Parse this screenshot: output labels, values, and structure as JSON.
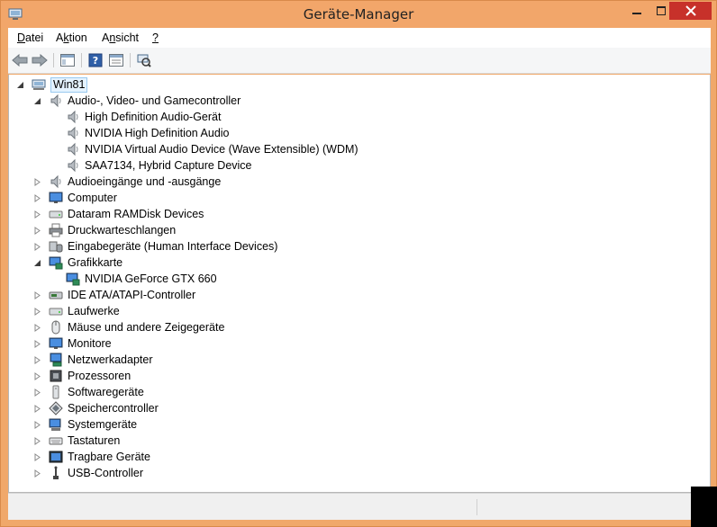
{
  "window": {
    "title": "Geräte-Manager",
    "accent": "#f2a66a",
    "close_color": "#c7312a"
  },
  "menu": {
    "items": [
      {
        "label": "Datei",
        "underline": "D",
        "rest": "atei"
      },
      {
        "label": "Aktion",
        "underline": "k",
        "pre": "A",
        "rest": "tion"
      },
      {
        "label": "Ansicht",
        "underline": "n",
        "pre": "A",
        "rest": "sicht"
      },
      {
        "label": "?",
        "underline": "?"
      }
    ]
  },
  "toolbar": {
    "buttons": [
      "back-arrow-icon",
      "forward-arrow-icon",
      "show-hide-console-icon",
      "help-icon",
      "properties-icon",
      "scan-hardware-icon"
    ]
  },
  "tree": {
    "root": {
      "label": "Win81",
      "icon": "computer-icon"
    },
    "nodes": [
      {
        "label": "Audio-, Video- und Gamecontroller",
        "icon": "speaker-icon",
        "expanded": true,
        "children": [
          {
            "label": "High Definition Audio-Gerät",
            "icon": "speaker-icon"
          },
          {
            "label": "NVIDIA High Definition Audio",
            "icon": "speaker-icon"
          },
          {
            "label": "NVIDIA Virtual Audio Device (Wave Extensible) (WDM)",
            "icon": "speaker-icon"
          },
          {
            "label": "SAA7134, Hybrid Capture Device",
            "icon": "speaker-icon"
          }
        ]
      },
      {
        "label": "Audioeingänge und -ausgänge",
        "icon": "speaker-icon",
        "expanded": false
      },
      {
        "label": "Computer",
        "icon": "monitor-icon",
        "expanded": false
      },
      {
        "label": "Dataram RAMDisk Devices",
        "icon": "drive-icon",
        "expanded": false
      },
      {
        "label": "Druckwarteschlangen",
        "icon": "printer-icon",
        "expanded": false
      },
      {
        "label": "Eingabegeräte (Human Interface Devices)",
        "icon": "hid-icon",
        "expanded": false
      },
      {
        "label": "Grafikkarte",
        "icon": "display-adapter-icon",
        "expanded": true,
        "children": [
          {
            "label": "NVIDIA GeForce GTX 660",
            "icon": "display-adapter-icon"
          }
        ]
      },
      {
        "label": "IDE ATA/ATAPI-Controller",
        "icon": "ide-icon",
        "expanded": false
      },
      {
        "label": "Laufwerke",
        "icon": "drive-icon",
        "expanded": false
      },
      {
        "label": "Mäuse und andere Zeigegeräte",
        "icon": "mouse-icon",
        "expanded": false
      },
      {
        "label": "Monitore",
        "icon": "monitor-icon",
        "expanded": false
      },
      {
        "label": "Netzwerkadapter",
        "icon": "network-icon",
        "expanded": false
      },
      {
        "label": "Prozessoren",
        "icon": "processor-icon",
        "expanded": false
      },
      {
        "label": "Softwaregeräte",
        "icon": "software-device-icon",
        "expanded": false
      },
      {
        "label": "Speichercontroller",
        "icon": "storage-controller-icon",
        "expanded": false
      },
      {
        "label": "Systemgeräte",
        "icon": "system-devices-icon",
        "expanded": false
      },
      {
        "label": "Tastaturen",
        "icon": "keyboard-icon",
        "expanded": false
      },
      {
        "label": "Tragbare Geräte",
        "icon": "portable-device-icon",
        "expanded": false
      },
      {
        "label": "USB-Controller",
        "icon": "usb-icon",
        "expanded": false
      }
    ]
  }
}
